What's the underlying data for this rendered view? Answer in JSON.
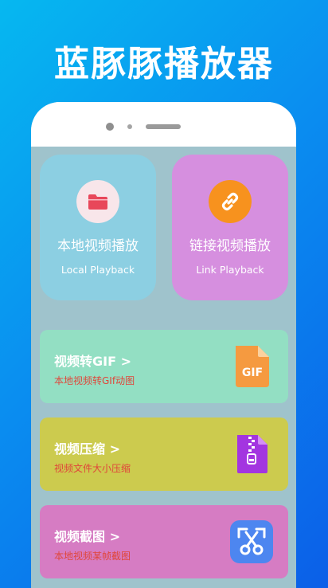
{
  "headline": "蓝豚豚播放器",
  "tiles": {
    "local": {
      "title": "本地视频播放",
      "subtitle": "Local Playback",
      "icon": "folder-icon"
    },
    "link": {
      "title": "链接视频播放",
      "subtitle": "Link Playback",
      "icon": "link-icon"
    }
  },
  "cards": {
    "gif": {
      "title": "视频转GIF >",
      "subtitle": "本地视频转GIf动图",
      "icon_text": "GIF",
      "icon": "gif-file-icon"
    },
    "compress": {
      "title": "视频压缩 >",
      "subtitle": "视频文件大小压缩",
      "icon": "zip-file-icon"
    },
    "screenshot": {
      "title": "视频截图 >",
      "subtitle": "本地视频某帧截图",
      "icon": "scissors-icon"
    }
  },
  "colors": {
    "background_start": "#06b8f0",
    "background_end": "#0b5fe8",
    "tile_local": "#8ccfe2",
    "tile_link": "#d68fdf",
    "card_gif": "#93dfc3",
    "card_compress": "#cccb4e",
    "card_screenshot": "#d67cc3",
    "subtitle_red": "#e0463a"
  }
}
